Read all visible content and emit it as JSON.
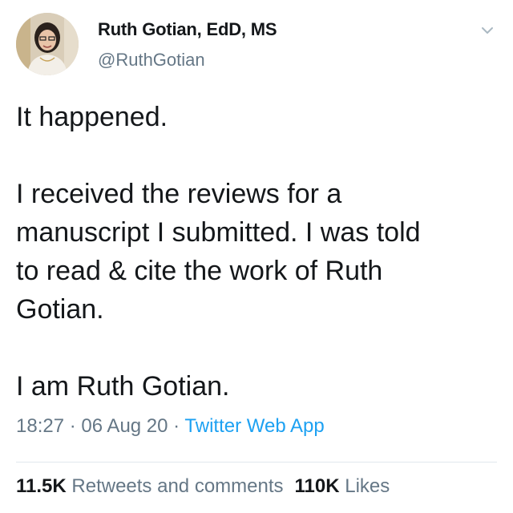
{
  "author": {
    "display_name": "Ruth Gotian, EdD, MS",
    "handle": "@RuthGotian"
  },
  "tweet": {
    "lines_para1": [
      "It happened."
    ],
    "lines_para2": [
      "I received the reviews for a",
      "manuscript I submitted. I was told",
      "to read & cite the work of Ruth",
      "Gotian."
    ],
    "lines_para3": [
      "I am Ruth Gotian."
    ]
  },
  "meta": {
    "time": "18:27",
    "separator": " · ",
    "date": "06 Aug 20",
    "source": "Twitter Web App"
  },
  "stats": {
    "retweets_count": "11.5K",
    "retweets_label": "Retweets and comments",
    "likes_count": "110K",
    "likes_label": "Likes"
  },
  "icons": {
    "menu": "chevron-down-icon",
    "avatar": "avatar"
  },
  "colors": {
    "text": "#14171a",
    "secondary": "#657786",
    "link": "#1da1f2",
    "divider": "#e1e8ed"
  }
}
